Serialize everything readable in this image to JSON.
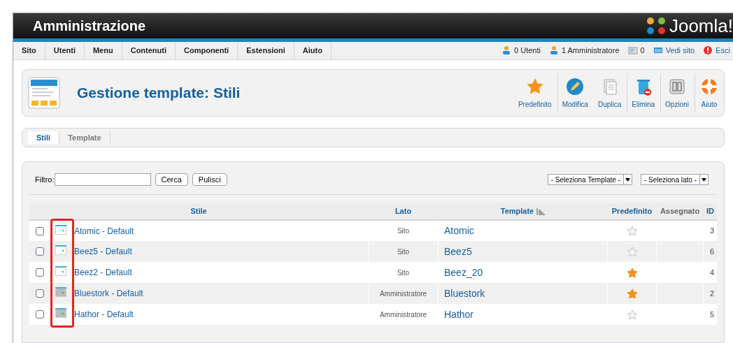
{
  "header": {
    "title": "Amministrazione",
    "logo": "Joomla!"
  },
  "menu": [
    "Sito",
    "Utenti",
    "Menu",
    "Contenuti",
    "Componenti",
    "Estensioni",
    "Aiuto"
  ],
  "status": [
    {
      "kind": "users",
      "label": "0 Utenti"
    },
    {
      "kind": "admins",
      "label": "1 Amministratore"
    },
    {
      "kind": "messages",
      "label": "0"
    },
    {
      "kind": "site",
      "label": "Vedi sito"
    },
    {
      "kind": "logout",
      "label": "Esci"
    }
  ],
  "toolbar": {
    "title": "Gestione template: Stili",
    "buttons": [
      {
        "kind": "default",
        "label": "Predefinito"
      },
      {
        "kind": "edit",
        "label": "Modifica"
      },
      {
        "kind": "copy",
        "label": "Duplica"
      },
      {
        "kind": "delete",
        "label": "Elimina"
      },
      {
        "kind": "options",
        "label": "Opzioni"
      },
      {
        "kind": "help",
        "label": "Aiuto"
      }
    ]
  },
  "tabs": [
    {
      "label": "Stili",
      "selected": true
    },
    {
      "label": "Template",
      "selected": false
    }
  ],
  "filter": {
    "label": "Filtro:",
    "buttons": [
      "Cerca",
      "Pulisci"
    ],
    "selects": [
      "- Seleziona Template -",
      "- Seleziona lato -"
    ]
  },
  "table": {
    "columns": [
      {
        "label": "Stile",
        "link": true,
        "sorted": false
      },
      {
        "label": "Lato",
        "link": true,
        "sorted": false
      },
      {
        "label": "Template",
        "link": true,
        "sorted": true
      },
      {
        "label": "Predefinito",
        "link": true,
        "sorted": false
      },
      {
        "label": "Assegnato",
        "link": false,
        "sorted": false
      },
      {
        "label": "ID",
        "link": true,
        "sorted": false
      }
    ],
    "rows": [
      {
        "checked": false,
        "kind": "site",
        "style": "Atomic - Default",
        "side": "Sito",
        "template": "Atomic",
        "default": false,
        "id": "3"
      },
      {
        "checked": false,
        "kind": "site",
        "style": "Beez5 - Default",
        "side": "Sito",
        "template": "Beez5",
        "default": false,
        "id": "6"
      },
      {
        "checked": false,
        "kind": "site",
        "style": "Beez2 - Default",
        "side": "Sito",
        "template": "Beez_20",
        "default": true,
        "id": "4"
      },
      {
        "checked": false,
        "kind": "admin",
        "style": "Bluestork - Default",
        "side": "Amministratore",
        "template": "Bluestork",
        "default": true,
        "id": "2"
      },
      {
        "checked": false,
        "kind": "admin",
        "style": "Hathor - Default",
        "side": "Amministratore",
        "template": "Hathor",
        "default": false,
        "id": "5"
      }
    ]
  }
}
